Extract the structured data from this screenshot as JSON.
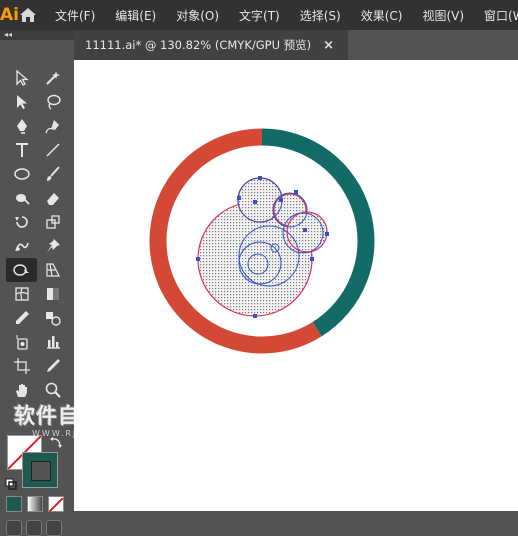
{
  "app": {
    "logo": "Ai"
  },
  "menu": [
    "文件(F)",
    "编辑(E)",
    "对象(O)",
    "文字(T)",
    "选择(S)",
    "效果(C)",
    "视图(V)",
    "窗口(W)"
  ],
  "tools_panel": {
    "collapse_label": "◂◂"
  },
  "document_tab": {
    "title": "11111.ai* @ 130.82% (CMYK/GPU 预览)",
    "close": "×"
  },
  "watermark": {
    "title": "软件自学网",
    "url": "WWW.RJZXW.COM"
  },
  "colors": {
    "ring_left": "#d44935",
    "ring_right": "#136b68",
    "selection": "#3454c4",
    "stroke_swatch": "#1f5a4e"
  }
}
